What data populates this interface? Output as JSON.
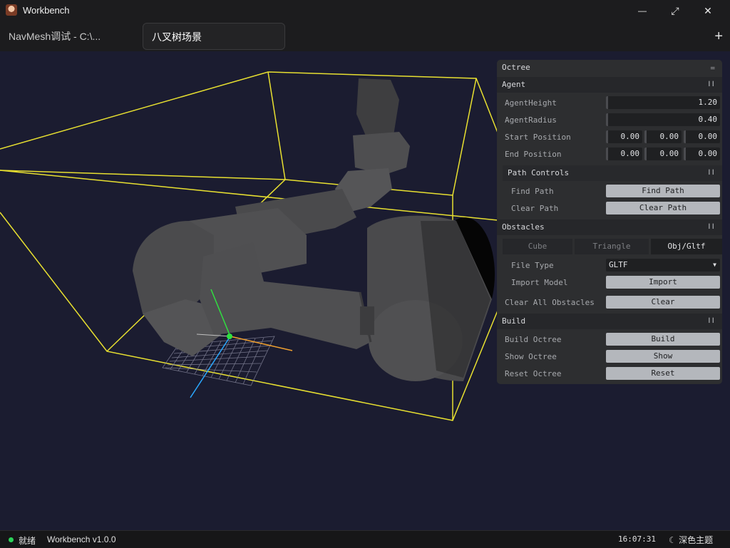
{
  "window": {
    "title": "Workbench",
    "controls": {
      "minimize": "—",
      "maximize": "⤢",
      "close": "✕"
    }
  },
  "tabs": [
    {
      "label": "NavMesh调试 - C:\\..."
    },
    {
      "label": "八叉树场景"
    }
  ],
  "tab_add": "+",
  "panel": {
    "title": "Octree",
    "title_icon": "=",
    "grip": "❙❙",
    "agent": {
      "title": "Agent",
      "agent_height_label": "AgentHeight",
      "agent_height": "1.20",
      "agent_radius_label": "AgentRadius",
      "agent_radius": "0.40",
      "start_label": "Start Position",
      "start": [
        "0.00",
        "0.00",
        "0.00"
      ],
      "end_label": "End Position",
      "end": [
        "0.00",
        "0.00",
        "0.00"
      ],
      "path_controls": {
        "title": "Path Controls",
        "find_label": "Find Path",
        "find_button": "Find Path",
        "clear_label": "Clear Path",
        "clear_button": "Clear Path"
      }
    },
    "obstacles": {
      "title": "Obstacles",
      "tabs": [
        "Cube",
        "Triangle",
        "Obj/Gltf"
      ],
      "selected_tab": "Obj/Gltf",
      "file_type_label": "File Type",
      "file_type": "GLTF",
      "import_label": "Import Model",
      "import_button": "Import",
      "clear_label": "Clear All Obstacles",
      "clear_button": "Clear"
    },
    "build": {
      "title": "Build",
      "build_label": "Build Octree",
      "build_button": "Build",
      "show_label": "Show Octree",
      "show_button": "Show",
      "reset_label": "Reset Octree",
      "reset_button": "Reset"
    }
  },
  "status": {
    "state": "就绪",
    "state_color": "#2bd45a",
    "version": "Workbench v1.0.0",
    "time": "16:07:31",
    "theme": "深色主题",
    "theme_icon": "moon-icon"
  },
  "colors": {
    "viewport_bg": "#1b1c30",
    "bounding_box": "#e8e030",
    "model": "#5a5a5c",
    "axis_x": "#f0a030",
    "axis_y": "#30e040",
    "axis_z": "#2aa8ff"
  }
}
